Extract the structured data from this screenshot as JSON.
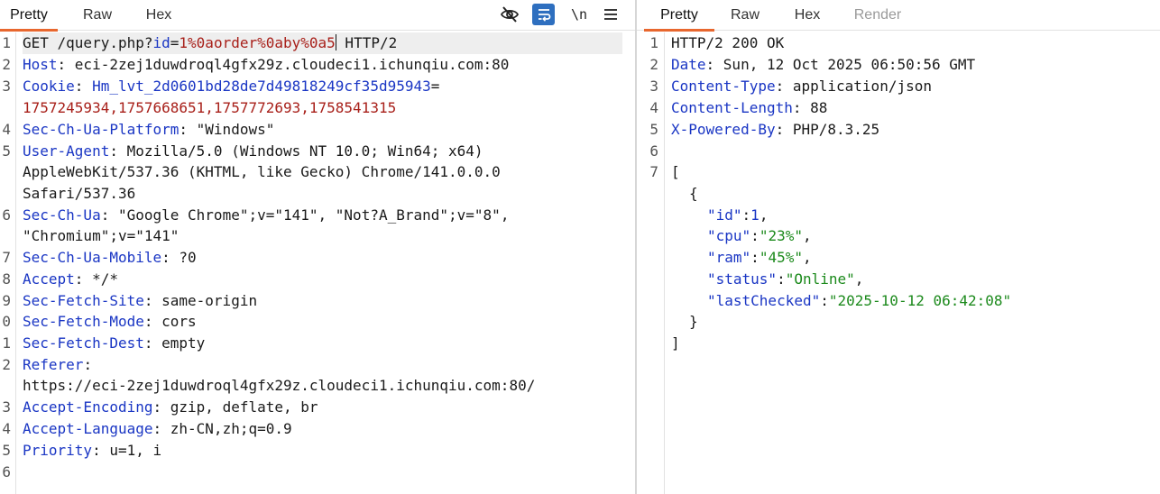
{
  "request": {
    "tabs": [
      {
        "label": "Pretty",
        "active": true
      },
      {
        "label": "Raw",
        "active": false
      },
      {
        "label": "Hex",
        "active": false
      }
    ],
    "toolbar": {
      "hide_icon": "eye-slash-icon",
      "wrap_icon": "word-wrap-icon",
      "newline_label": "\\n",
      "menu_icon": "hamburger-menu-icon"
    },
    "line_numbers": [
      "1",
      "2",
      "3",
      "",
      "4",
      "5",
      "",
      "",
      "6",
      "",
      "7",
      "8",
      "9",
      "0",
      "1",
      "2",
      "",
      "3",
      "4",
      "5",
      "6"
    ],
    "lines": [
      {
        "method": "GET /query.php?",
        "param": "id",
        "eq": "=",
        "pval": "1%0aorder%0aby%0a5",
        "tail": " HTTP/2"
      },
      {
        "name": "Host",
        "value": ": eci-2zej1duwdroql4gfx29z.cloudeci1.ichunqiu.com:80"
      },
      {
        "name": "Cookie",
        "sep": ": ",
        "cookie_name": "Hm_lvt_2d0601bd28de7d49818249cf35d95943",
        "cookie_eq": "="
      },
      {
        "cookie_cont": "1757245934,1757668651,1757772693,1758541315"
      },
      {
        "name": "Sec-Ch-Ua-Platform",
        "value": ": \"Windows\""
      },
      {
        "name": "User-Agent",
        "value": ": Mozilla/5.0 (Windows NT 10.0; Win64; x64)"
      },
      {
        "cont": "AppleWebKit/537.36 (KHTML, like Gecko) Chrome/141.0.0.0"
      },
      {
        "cont": "Safari/537.36"
      },
      {
        "name": "Sec-Ch-Ua",
        "value": ": \"Google Chrome\";v=\"141\", \"Not?A_Brand\";v=\"8\","
      },
      {
        "cont": "\"Chromium\";v=\"141\""
      },
      {
        "name": "Sec-Ch-Ua-Mobile",
        "value": ": ?0"
      },
      {
        "name": "Accept",
        "value": ": */*"
      },
      {
        "name": "Sec-Fetch-Site",
        "value": ": same-origin"
      },
      {
        "name": "Sec-Fetch-Mode",
        "value": ": cors"
      },
      {
        "name": "Sec-Fetch-Dest",
        "value": ": empty"
      },
      {
        "name": "Referer",
        "value": ":"
      },
      {
        "cont": "https://eci-2zej1duwdroql4gfx29z.cloudeci1.ichunqiu.com:80/"
      },
      {
        "name": "Accept-Encoding",
        "value": ": gzip, deflate, br"
      },
      {
        "name": "Accept-Language",
        "value": ": zh-CN,zh;q=0.9"
      },
      {
        "name": "Priority",
        "value": ": u=1, i"
      },
      {
        "cont": ""
      }
    ]
  },
  "response": {
    "tabs": [
      {
        "label": "Pretty",
        "active": true
      },
      {
        "label": "Raw",
        "active": false
      },
      {
        "label": "Hex",
        "active": false
      },
      {
        "label": "Render",
        "active": false
      }
    ],
    "status_line": "HTTP/2 200 OK",
    "headers": [
      {
        "name": "Date",
        "value": ": Sun, 12 Oct 2025 06:50:56 GMT"
      },
      {
        "name": "Content-Type",
        "value": ": application/json"
      },
      {
        "name": "Content-Length",
        "value": ": 88"
      },
      {
        "name": "X-Powered-By",
        "value": ": PHP/8.3.25"
      }
    ],
    "line_numbers": [
      "1",
      "2",
      "3",
      "4",
      "5",
      "6",
      "7"
    ],
    "json": {
      "open_bracket": "[",
      "open_brace": "{",
      "fields": [
        {
          "key": "\"id\"",
          "value": "1",
          "kind": "num",
          "comma": ","
        },
        {
          "key": "\"cpu\"",
          "value": "\"23%\"",
          "kind": "str",
          "comma": ","
        },
        {
          "key": "\"ram\"",
          "value": "\"45%\"",
          "kind": "str",
          "comma": ","
        },
        {
          "key": "\"status\"",
          "value": "\"Online\"",
          "kind": "str",
          "comma": ","
        },
        {
          "key": "\"lastChecked\"",
          "value": "\"2025-10-12 06:42:08\"",
          "kind": "str",
          "comma": ""
        }
      ],
      "close_brace": "}",
      "close_bracket": "]"
    }
  }
}
